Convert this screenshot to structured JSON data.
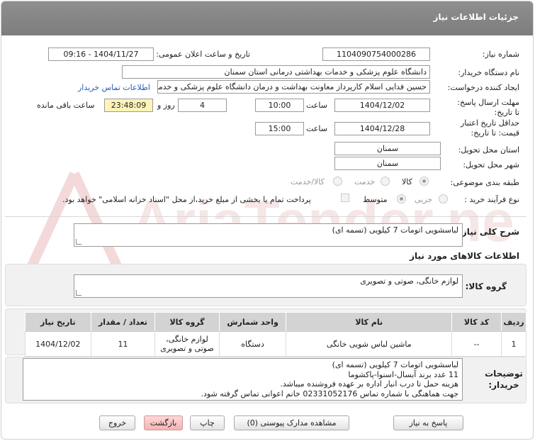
{
  "header": {
    "title": "جزئیات اطلاعات نیاز"
  },
  "labels": {
    "need_number": "شماره نیاز:",
    "announce_datetime": "تاریخ و ساعت اعلان عمومی:",
    "buyer_org": "نام دستگاه خریدار:",
    "requester": "ایجاد کننده درخواست:",
    "reply_deadline": "مهلت ارسال پاسخ: تا تاریخ:",
    "price_validity": "حداقل تاریخ اعتبار قیمت: تا تاریخ:",
    "delivery_province": "استان محل تحویل:",
    "delivery_city": "شهر محل تحویل:",
    "category": "طبقه بندی موضوعی:",
    "process_type": "نوع فرآیند خرید :",
    "time_word": "ساعت",
    "day_and": "روز و",
    "remaining": "ساعت باقی مانده",
    "general_desc": "شرح کلی نیاز:",
    "goods_info": "اطلاعات کالاهای مورد نیاز",
    "goods_group": "گروه کالا:",
    "buyer_notes": "توضیحات خریدار:"
  },
  "fields": {
    "need_number": "1104090754000286",
    "announce_datetime": "1404/11/27 - 09:16",
    "buyer_org": "دانشگاه علوم پزشکی و خدمات بهداشتی  درمانی استان سمنان",
    "requester": "حسین فدایی اسلام کارپرداز معاونت بهداشت و درمان دانشگاه علوم پزشکی و خدمات بهداشتی درمانی",
    "contact_link": "اطلاعات تماس خریدار",
    "reply_date": "1404/12/02",
    "reply_time": "10:00",
    "reply_days": "4",
    "reply_remaining": "23:48:09",
    "validity_date": "1404/12/28",
    "validity_time": "15:00",
    "province": "سمنان",
    "city": "سمنان"
  },
  "category_options": [
    {
      "label": "کالا",
      "selected": true
    },
    {
      "label": "خدمت",
      "selected": false
    },
    {
      "label": "کالا/خدمت",
      "selected": false
    }
  ],
  "process_options": [
    {
      "label": "جزیی",
      "selected": true
    },
    {
      "label": "متوسط",
      "selected": false
    }
  ],
  "payment_note": "پرداخت تمام یا بخشی از مبلغ خرید،از محل \"اسناد خزانه اسلامی\" خواهد بود.",
  "general_desc": "لباسشویی اتومات 7 کیلویی (تسمه ای)",
  "goods_group": "لوازم خانگی، صوتی و تصویری",
  "table": {
    "headers": [
      "ردیف",
      "کد کالا",
      "نام کالا",
      "واحد شمارش",
      "گروه کالا",
      "تعداد / مقدار",
      "تاریخ نیاز"
    ],
    "rows": [
      {
        "row": "1",
        "code": "--",
        "name": "ماشین لباس شویی خانگی",
        "unit": "دستگاه",
        "group": "لوازم خانگی، صوتی و تصویری",
        "qty": "11",
        "date": "1404/12/02"
      }
    ]
  },
  "notes": [
    "لباسشویی اتومات 7 کیلویی (تسمه ای)",
    "11 عدد برند آبسال-اسنوا-پاکشوما",
    "هزینه حمل تا درب انبار اداره بر عهده فروشنده میباشد.",
    "جهت هماهنگی با شماره تماس 02331052176 خانم اعوانی تماس گرفته شود."
  ],
  "buttons": {
    "reply": "پاسخ به نیاز",
    "view_docs": "مشاهده مدارک پیوستی (0)",
    "print": "چاپ",
    "back": "بازگشت",
    "exit": "خروج"
  },
  "watermark_text": "AriaTender.net"
}
